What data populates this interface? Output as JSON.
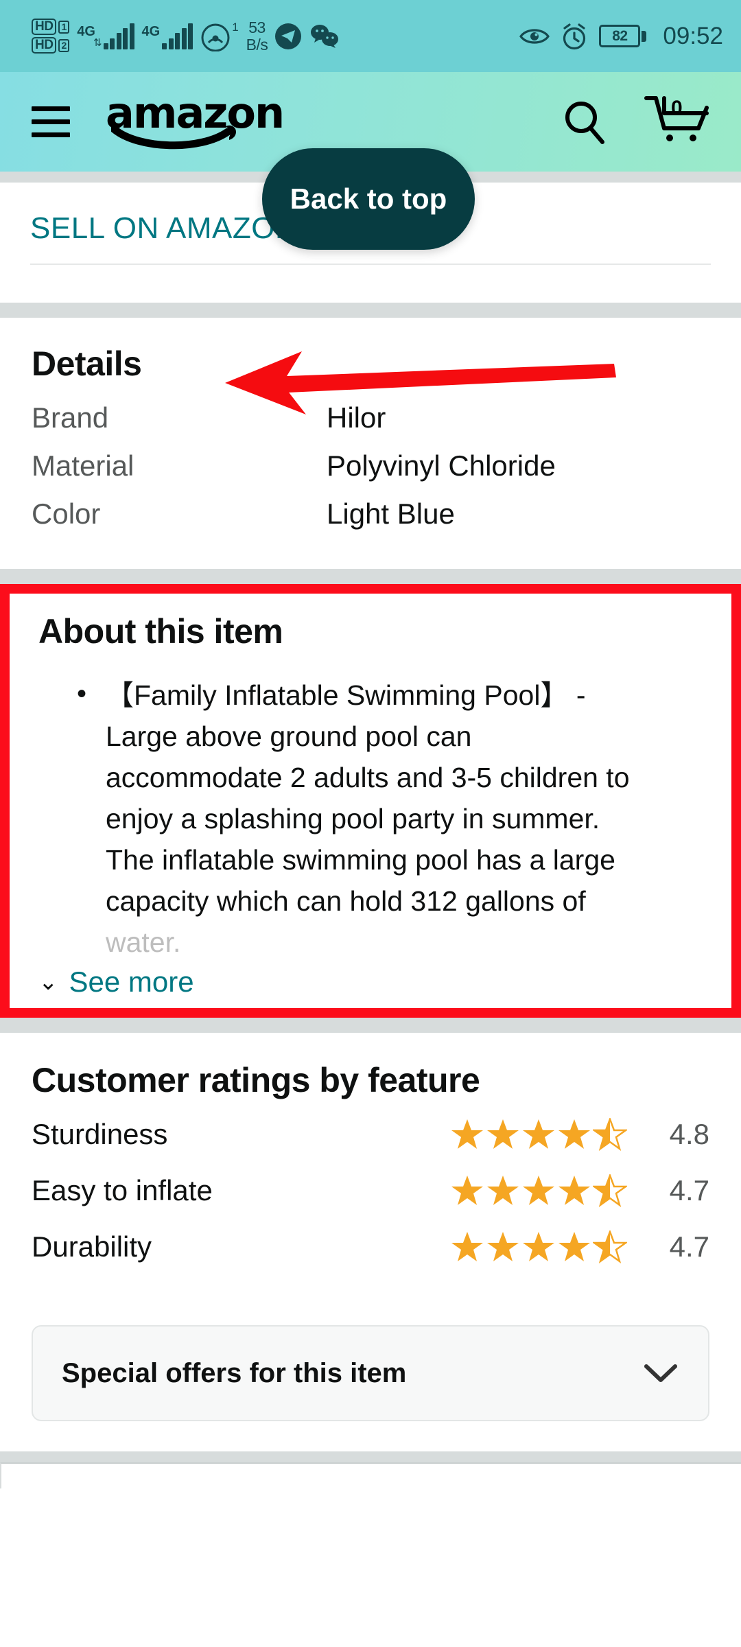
{
  "status_bar": {
    "hd_badges": [
      {
        "label": "HD",
        "sim": "1"
      },
      {
        "label": "HD",
        "sim": "2"
      }
    ],
    "signal_1": {
      "network": "4G",
      "bars": 5,
      "transfer_indicator": "⇅"
    },
    "signal_2": {
      "network": "4G",
      "bars": 5
    },
    "hotspot_sup": "1",
    "data_rate_value": "53",
    "data_rate_unit": "B/s",
    "app_icons": [
      "telegram-icon",
      "wechat-icon"
    ],
    "eye_icon": "eye-icon",
    "alarm_icon": "alarm-clock-icon",
    "battery_percent": "82",
    "time": "09:52"
  },
  "header": {
    "menu_icon": "hamburger-menu-icon",
    "logo_text": "amazon",
    "search_icon": "search-icon",
    "cart_icon": "shopping-cart-icon",
    "cart_count": "0"
  },
  "sell_bar": {
    "link_label": "SELL ON AMAZON",
    "back_to_top_label": "Back to top"
  },
  "details": {
    "title": "Details",
    "rows": [
      {
        "key": "Brand",
        "value": "Hilor"
      },
      {
        "key": "Material",
        "value": "Polyvinyl Chloride"
      },
      {
        "key": "Color",
        "value": "Light Blue"
      }
    ]
  },
  "about": {
    "title": "About this item",
    "bullet_lines": [
      "【Family Inflatable Swimming Pool】 -",
      "Large above ground pool can",
      "accommodate 2 adults and 3-5 children to",
      "enjoy a splashing pool party in summer.",
      "The inflatable swimming pool has a large",
      "capacity which can hold 312 gallons of"
    ],
    "faded_line": "water.",
    "see_more_label": "See more",
    "see_more_icon": "chevron-down-icon",
    "highlight_color": "#fc0d1b"
  },
  "ratings": {
    "title": "Customer ratings by feature",
    "rows": [
      {
        "label": "Sturdiness",
        "score": "4.8",
        "stars": 4.5
      },
      {
        "label": "Easy to inflate",
        "score": "4.7",
        "stars": 4.5
      },
      {
        "label": "Durability",
        "score": "4.7",
        "stars": 4.5
      }
    ],
    "star_color": "#f5a623"
  },
  "offers": {
    "label": "Special offers for this item",
    "expand_icon": "chevron-down-icon"
  },
  "annotation": {
    "arrow_color": "#f50c10",
    "arrow_direction": "left",
    "points_to": "Details"
  },
  "theme": {
    "link_teal": "#007782",
    "dark_teal": "#073c41",
    "status_bar_bg": "#6dd0d3",
    "divider_gray": "#d7dcdc"
  }
}
